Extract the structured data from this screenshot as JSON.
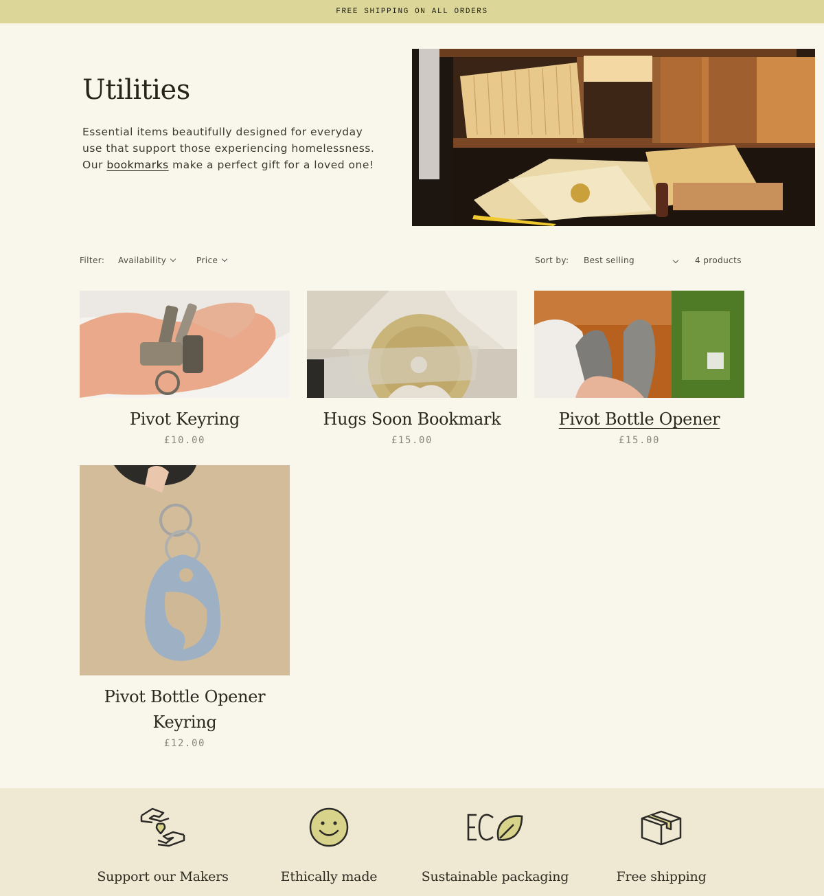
{
  "announcement": {
    "text": "FREE SHIPPING ON ALL ORDERS"
  },
  "hero": {
    "title": "Utilities",
    "desc_before": "Essential items beautifully designed for everyday use that support those experiencing homelessness. Our ",
    "desc_link": "bookmarks",
    "desc_after": " make a perfect gift for a loved one!"
  },
  "filters": {
    "label": "Filter:",
    "availability": "Availability",
    "price": "Price",
    "sort_label": "Sort by:",
    "sort_value": "Best selling",
    "count": "4 products"
  },
  "products": [
    {
      "title": "Pivot Keyring",
      "price": "£10.00"
    },
    {
      "title": "Hugs Soon Bookmark",
      "price": "£15.00"
    },
    {
      "title": "Pivot Bottle Opener",
      "price": "£15.00"
    },
    {
      "title": "Pivot Bottle Opener Keyring",
      "price": "£12.00"
    }
  ],
  "features": [
    {
      "label": "Support our Makers",
      "icon": "hands-heart-icon"
    },
    {
      "label": "Ethically made",
      "icon": "smiley-icon"
    },
    {
      "label": "Sustainable packaging",
      "icon": "eco-leaf-icon"
    },
    {
      "label": "Free shipping",
      "icon": "package-box-icon"
    }
  ],
  "colors": {
    "background": "#f9f7ec",
    "announcement_bg": "#dcd698",
    "footer_bg": "#efe9d3",
    "accent": "#d7d38a"
  }
}
